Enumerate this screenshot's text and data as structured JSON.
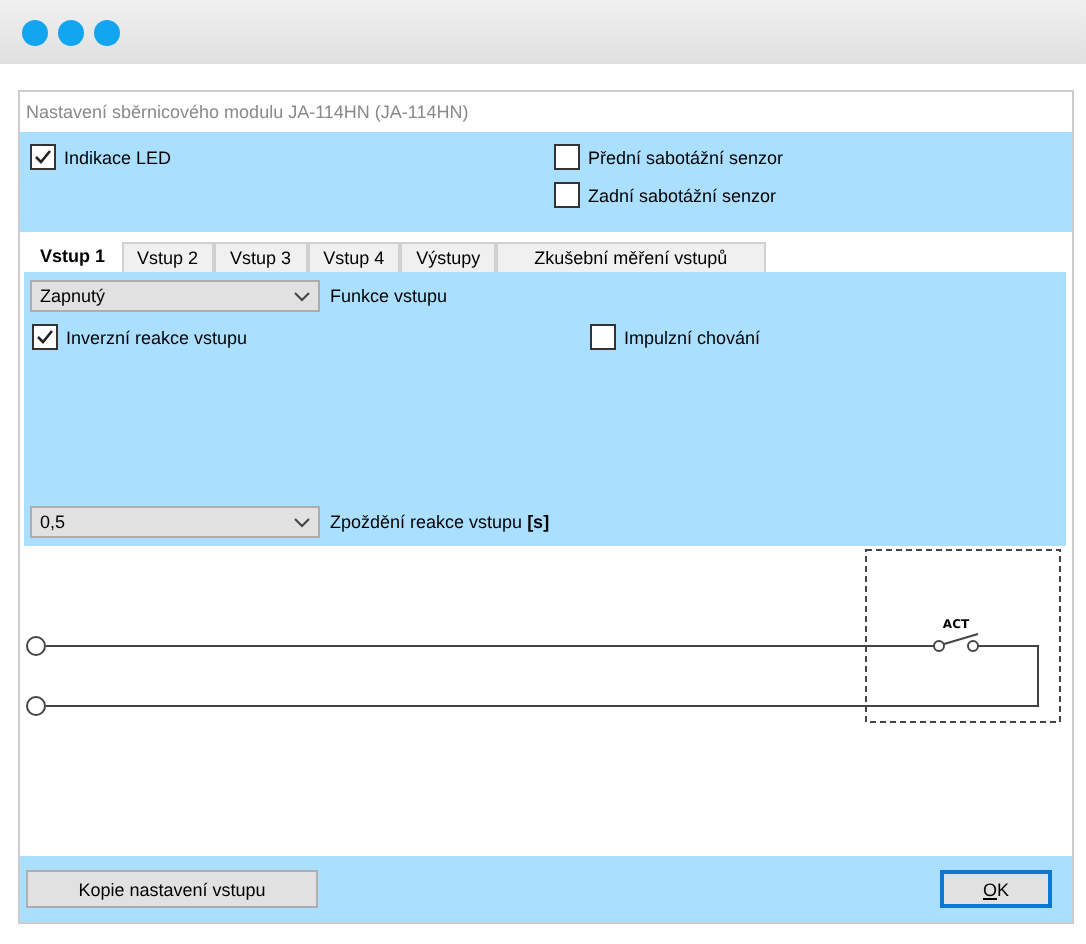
{
  "window": {
    "title": "Nastavení sběrnicového modulu JA-114HN (JA-114HN)"
  },
  "indicators": [
    {
      "label": "Indikace LED",
      "checked": true
    }
  ],
  "tamper_sensors": [
    {
      "label": "Přední sabotážní senzor",
      "checked": false
    },
    {
      "label": "Zadní sabotážní senzor",
      "checked": false
    }
  ],
  "tabs": [
    {
      "label": "Vstup 1",
      "selected": true
    },
    {
      "label": "Vstup 2",
      "selected": false
    },
    {
      "label": "Vstup 3",
      "selected": false
    },
    {
      "label": "Vstup 4",
      "selected": false
    },
    {
      "label": "Výstupy",
      "selected": false
    },
    {
      "label": "Zkušební měření vstupů",
      "selected": false
    }
  ],
  "input_settings": {
    "function": {
      "value": "Zapnutý",
      "label": "Funkce vstupu"
    },
    "inverse": {
      "label": "Inverzní reakce vstupu",
      "checked": true
    },
    "pulse": {
      "label": "Impulzní chování",
      "checked": false
    },
    "delay": {
      "value": "0,5",
      "label": "Zpoždění reakce vstupu **[s]**"
    }
  },
  "diagram": {
    "switch_label": "ACT"
  },
  "buttons": [
    {
      "label": "Kopie nastavení vstupu",
      "default": false
    },
    {
      "label": "OK",
      "default": true
    }
  ]
}
